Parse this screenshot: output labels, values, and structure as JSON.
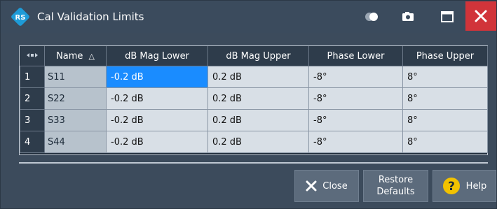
{
  "window": {
    "title": "Cal Validation Limits"
  },
  "table": {
    "headers": {
      "name": "Name",
      "sort_indicator": "△",
      "dbmag_lower": "dB Mag Lower",
      "dbmag_upper": "dB Mag Upper",
      "phase_lower": "Phase Lower",
      "phase_upper": "Phase Upper"
    },
    "rows": [
      {
        "num": "1",
        "name": "S11",
        "dbmag_lower": "-0.2 dB",
        "dbmag_upper": "0.2 dB",
        "phase_lower": "-8°",
        "phase_upper": "8°"
      },
      {
        "num": "2",
        "name": "S22",
        "dbmag_lower": "-0.2 dB",
        "dbmag_upper": "0.2 dB",
        "phase_lower": "-8°",
        "phase_upper": "8°"
      },
      {
        "num": "3",
        "name": "S33",
        "dbmag_lower": "-0.2 dB",
        "dbmag_upper": "0.2 dB",
        "phase_lower": "-8°",
        "phase_upper": "8°"
      },
      {
        "num": "4",
        "name": "S44",
        "dbmag_lower": "-0.2 dB",
        "dbmag_upper": "0.2 dB",
        "phase_lower": "-8°",
        "phase_upper": "8°"
      }
    ],
    "selected_cell": "rows.0.dbmag_lower"
  },
  "buttons": {
    "close_label": "Close",
    "restore_line1": "Restore",
    "restore_line2": "Defaults",
    "help_label": "Help"
  },
  "icons": {
    "logo": "rohde-schwarz-logo-icon",
    "toggle": "toggle-icon",
    "camera": "camera-icon",
    "maximize": "maximize-icon",
    "close": "close-icon",
    "corner": "column-resize-icon",
    "close_button": "x-icon",
    "help_button": "question-icon"
  },
  "colors": {
    "titlebar_bg": "#3b4b5d",
    "close_bg": "#d1343a",
    "selected_cell_bg": "#1a8cff",
    "help_icon": "#f2c200"
  }
}
